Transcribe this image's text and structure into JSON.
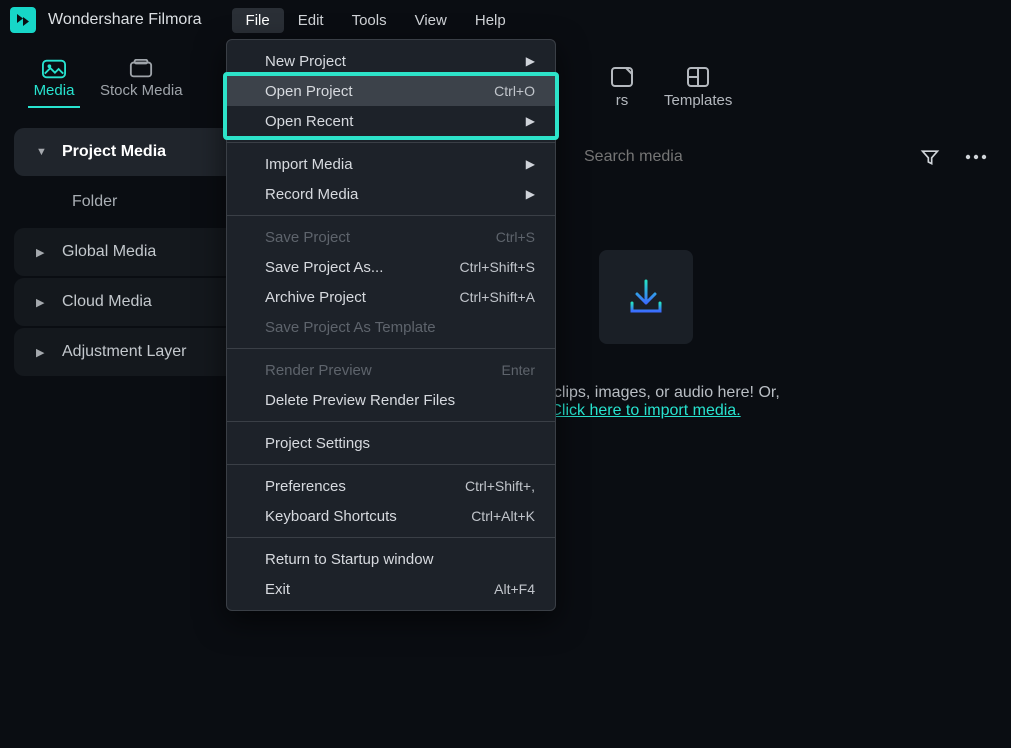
{
  "app": {
    "title": "Wondershare Filmora"
  },
  "menubar": [
    "File",
    "Edit",
    "Tools",
    "View",
    "Help"
  ],
  "active_menu": "File",
  "file_menu": {
    "new_project": "New Project",
    "open_project": {
      "label": "Open Project",
      "shortcut": "Ctrl+O"
    },
    "open_recent": "Open Recent",
    "import_media": "Import Media",
    "record_media": "Record Media",
    "save_project": {
      "label": "Save Project",
      "shortcut": "Ctrl+S"
    },
    "save_project_as": {
      "label": "Save Project As...",
      "shortcut": "Ctrl+Shift+S"
    },
    "archive_project": {
      "label": "Archive Project",
      "shortcut": "Ctrl+Shift+A"
    },
    "save_template": "Save Project As Template",
    "render_preview": {
      "label": "Render Preview",
      "shortcut": "Enter"
    },
    "delete_preview": "Delete Preview Render Files",
    "project_settings": "Project Settings",
    "preferences": {
      "label": "Preferences",
      "shortcut": "Ctrl+Shift+,"
    },
    "keyboard_shortcuts": {
      "label": "Keyboard Shortcuts",
      "shortcut": "Ctrl+Alt+K"
    },
    "return_startup": "Return to Startup window",
    "exit": {
      "label": "Exit",
      "shortcut": "Alt+F4"
    }
  },
  "left_tabs": {
    "media": "Media",
    "stock": "Stock Media"
  },
  "right_tabs": {
    "stickers": "rs",
    "templates": "Templates"
  },
  "sidebar": {
    "project_media": "Project Media",
    "folder": "Folder",
    "global_media": "Global Media",
    "cloud_media": "Cloud Media",
    "adjustment_layer": "Adjustment Layer"
  },
  "search": {
    "placeholder": "Search media"
  },
  "dropzone": {
    "line1": "video clips, images, or audio here! Or,",
    "link": "Click here to import media."
  }
}
